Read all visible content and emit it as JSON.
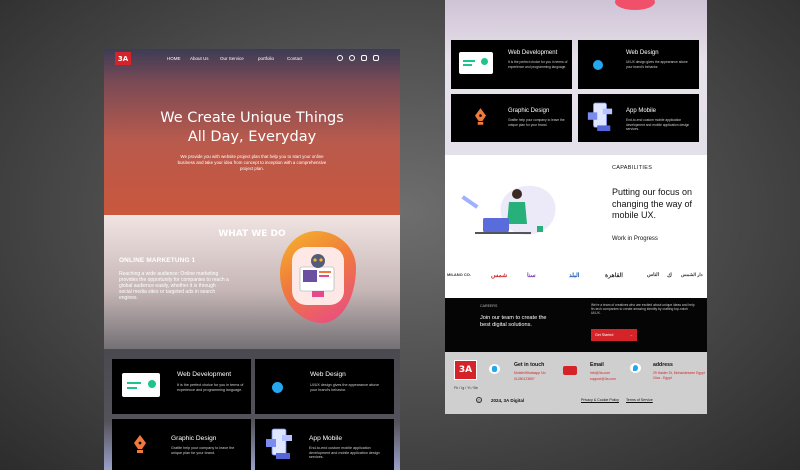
{
  "nav": {
    "logo": "3A",
    "links": [
      "HOME",
      "About Us",
      "Our Service",
      "portfolio",
      "Contact"
    ]
  },
  "hero": {
    "title_line1": "We Create Unique Things",
    "title_line2": "All Day, Everyday",
    "description": "We provide you with website project plan that help you to start your online business and take your idea from concept to inception with a comprehensive project plan."
  },
  "what_we_do": {
    "title": "WHAT WE DO",
    "item_title": "ONLINE MARKETUNG 1",
    "item_desc": "Reaching a wide audience: Online marketing provides the opportunity for companies to reach a global audience easily, whether it is through social media sites or targeted ads in search engines."
  },
  "services": [
    {
      "title": "Web Development",
      "desc": "It is the perfect choice for you in terms of experience and programming language."
    },
    {
      "title": "Web Design",
      "desc": "UI/UX design gives the appearance above your brand's behavior."
    },
    {
      "title": "Graphic Design",
      "desc": "Grafite help your company to leave the unique plan for your brand."
    },
    {
      "title": "App Mobile",
      "desc": "End-to-end custom mobile application development and mobile application design services."
    }
  ],
  "capabilities": {
    "label": "CAPABILITIES",
    "heading": "Putting our focus on changing the way of mobile UX.",
    "status": "Work in Progress"
  },
  "partner_logos": [
    "MILANO CO.",
    "شمس",
    "سنا",
    "البلد",
    "القاهرة",
    "الناس",
    "ك",
    "دار الشمس"
  ],
  "careers": {
    "label": "CAREERS",
    "heading": "Join our team to create the best digital solutions.",
    "desc": "We're a team of creatives who are excited about unique ideas and help fin-tech companies to create amazing identity by crafting top-notch UI/UX.",
    "button": "Get Started"
  },
  "footer": {
    "logo": "3A",
    "social": "Fb / Ig / Yt / Be",
    "get_in_touch": "Get in touch",
    "touch_desc": "Mobile/Whatsapp No",
    "phone": "01280123897",
    "email_label": "Email",
    "email1": "info@3a.com",
    "email2": "support@3a.com",
    "address_label": "address",
    "address": "29 Haider St, Mohandeseen Egypt Giza - Egypt",
    "copyright": "2024, 3A Digital",
    "links": [
      "Privacy & Cookie Policy",
      "Terms of Service"
    ]
  },
  "colors": {
    "brand": "#d4242a",
    "orange": "#f07a3c"
  }
}
